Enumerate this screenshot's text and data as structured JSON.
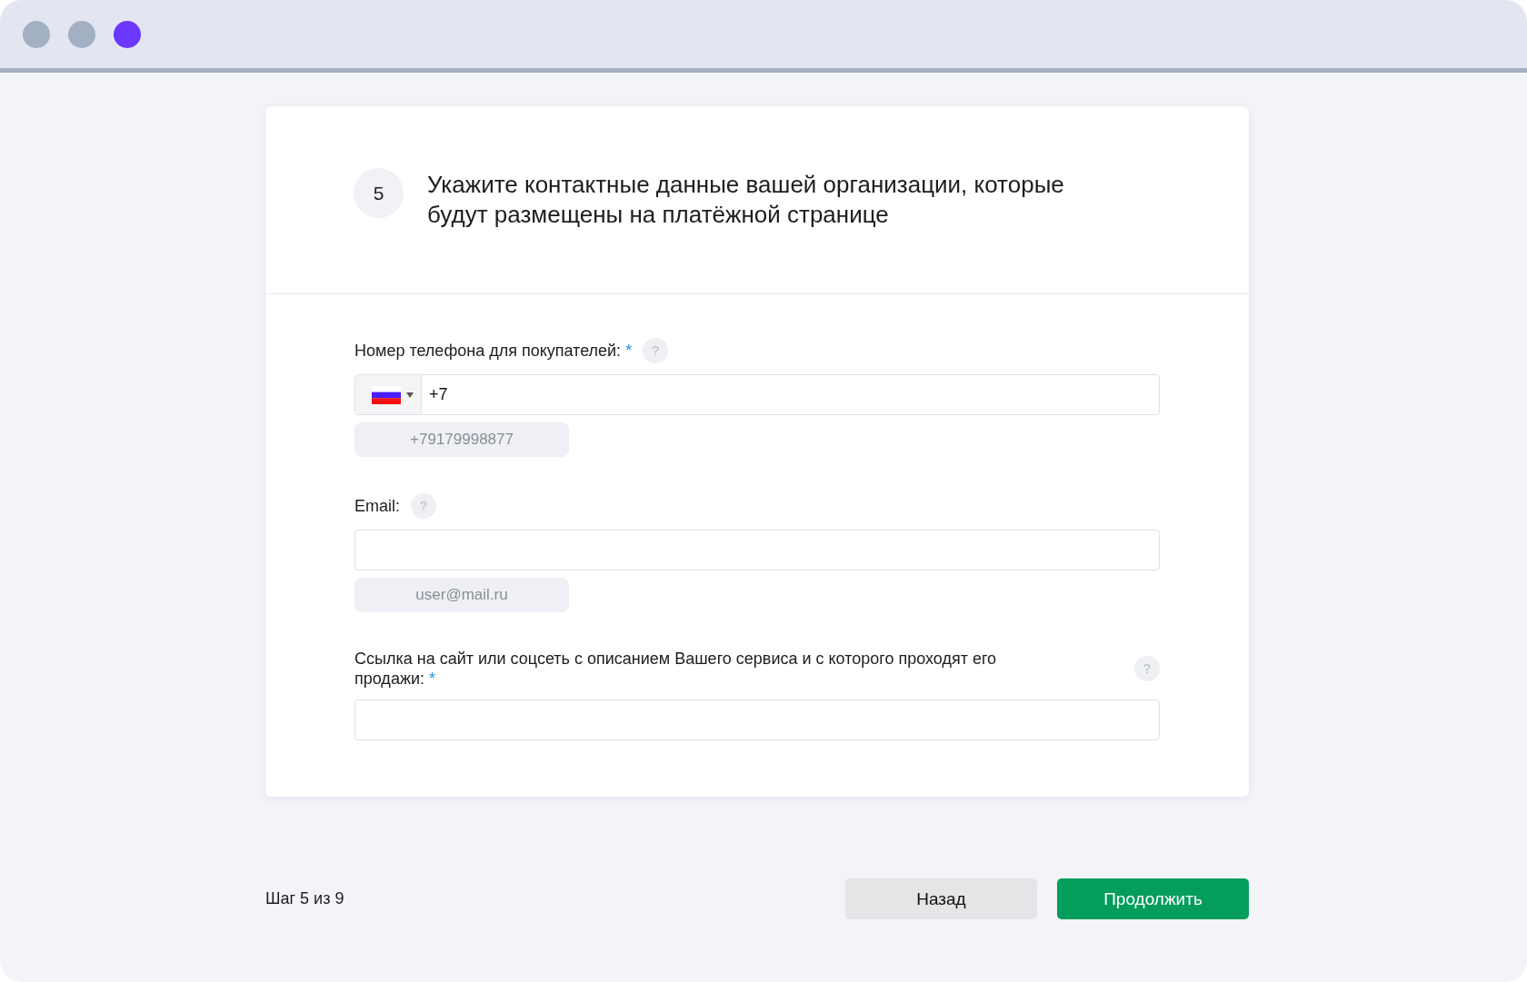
{
  "window": {
    "controls": [
      {
        "color": "#a3afc3"
      },
      {
        "color": "#a3afc3"
      },
      {
        "color": "#6a38ff"
      }
    ]
  },
  "step": {
    "number": "5",
    "title": "Укажите контактные данные вашей организации, которые будут размещены на платёжной странице"
  },
  "fields": [
    {
      "kind": "phone",
      "label": "Номер телефона для покупателей:",
      "required_mark": "*",
      "help": "?",
      "value": "+7",
      "example": "+79179998877"
    },
    {
      "kind": "email",
      "label": "Email:",
      "help": "?",
      "example": "user@mail.ru"
    },
    {
      "kind": "link",
      "label": "Ссылка на сайт или соцсеть с описанием Вашего сервиса и с которого проходят его продажи:",
      "required_mark": "*",
      "help": "?"
    }
  ],
  "footer": {
    "progress": "Шаг 5 из 9",
    "buttons": [
      {
        "label": "Назад",
        "kind": "secondary"
      },
      {
        "label": "Продолжить",
        "kind": "primary"
      }
    ]
  }
}
